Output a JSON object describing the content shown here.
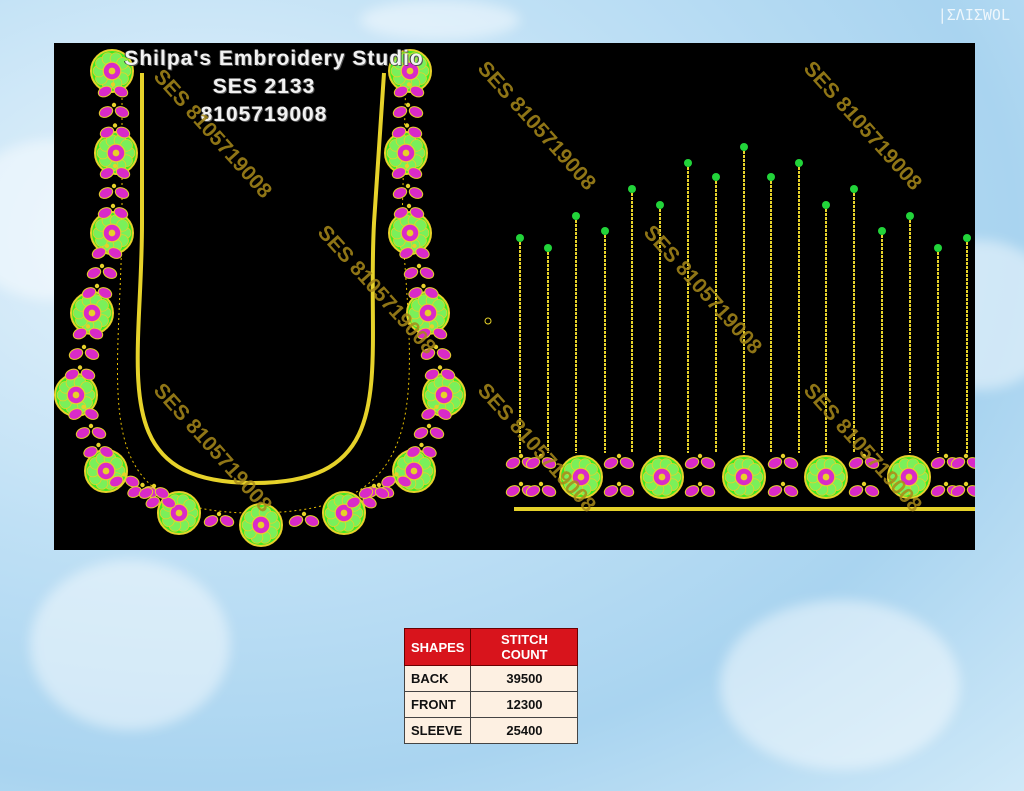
{
  "header": {
    "studio_name": "Shilpa's Embroidery Studio",
    "design_code": "SES  2133",
    "phone": "8105719008"
  },
  "watermark_text": "SES 8105719008",
  "corner_mark": "|ΣΛΙΣWOL",
  "colors": {
    "panel_bg": "#000000",
    "gold": "#e6d22a",
    "green": "#3ee826",
    "magenta": "#d92ac8",
    "bead": "#22d43a",
    "table_header": "#d8141c"
  },
  "stitch_table": {
    "headers": [
      "SHAPES",
      "STITCH COUNT"
    ],
    "rows": [
      {
        "shape": "BACK",
        "count": "39500"
      },
      {
        "shape": "FRONT",
        "count": "12300"
      },
      {
        "shape": "SLEEVE",
        "count": "25400"
      }
    ]
  }
}
